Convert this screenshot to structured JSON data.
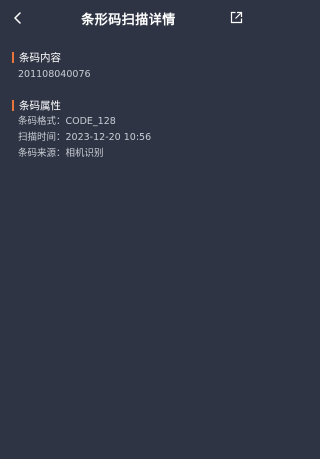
{
  "header": {
    "title": "条形码扫描详情",
    "back_icon": "chevron-left-icon",
    "share_icon": "share-icon"
  },
  "content_section": {
    "title": "条码内容",
    "value": "201108040076"
  },
  "attributes_section": {
    "title": "条码属性",
    "rows": [
      "条码格式：CODE_128",
      "扫描时间：2023-12-20 10:56",
      "条码来源：相机识别"
    ]
  },
  "colors": {
    "background": "#2f3444",
    "accent": "#e8753b"
  }
}
